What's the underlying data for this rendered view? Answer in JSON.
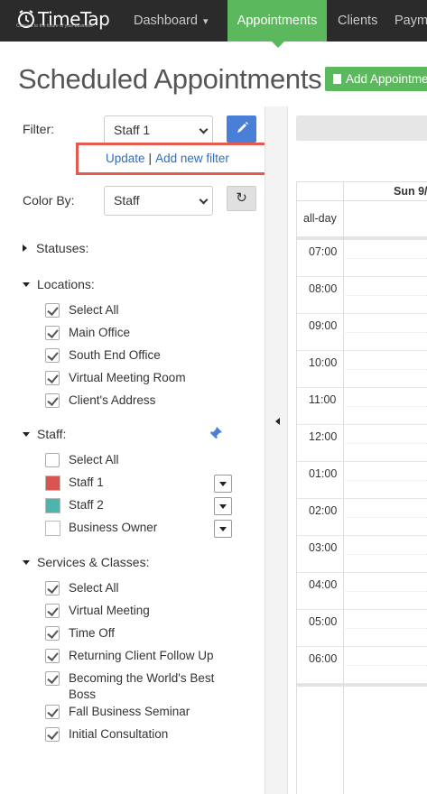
{
  "nav": {
    "logo_text": "TimeTap",
    "logo_tagline": "Connect to the future of your business",
    "items": [
      {
        "label": "Dashboard",
        "active": false,
        "dropdown": true
      },
      {
        "label": "Appointments",
        "active": true,
        "dropdown": false
      },
      {
        "label": "Clients",
        "active": false,
        "dropdown": false
      },
      {
        "label": "Paym",
        "active": false,
        "dropdown": false
      }
    ]
  },
  "header": {
    "title": "Scheduled Appointments",
    "add_button_label": "Add Appointme"
  },
  "filter": {
    "label": "Filter:",
    "selected": "Staff 1",
    "update_link": "Update",
    "separator": "|",
    "add_filter_link": "Add new filter",
    "edit_icon": "pencil-icon"
  },
  "color_by": {
    "label": "Color By:",
    "selected": "Staff",
    "refresh_icon": "refresh-icon"
  },
  "sections": {
    "statuses": {
      "label": "Statuses:",
      "expanded": false
    },
    "locations": {
      "label": "Locations:",
      "expanded": true,
      "items": [
        {
          "label": "Select All",
          "checked": true
        },
        {
          "label": "Main Office",
          "checked": true
        },
        {
          "label": "South End Office",
          "checked": true
        },
        {
          "label": "Virtual Meeting Room",
          "checked": true
        },
        {
          "label": "Client's Address",
          "checked": true
        }
      ]
    },
    "staff": {
      "label": "Staff:",
      "expanded": true,
      "pin_icon": "pin-icon",
      "items": [
        {
          "label": "Select All",
          "color": null
        },
        {
          "label": "Staff 1",
          "color": "#d9534f"
        },
        {
          "label": "Staff 2",
          "color": "#4db6ac"
        },
        {
          "label": "Business Owner",
          "color": "#ffffff"
        }
      ]
    },
    "services": {
      "label": "Services & Classes:",
      "expanded": true,
      "items": [
        {
          "label": "Select All",
          "checked": true
        },
        {
          "label": "Virtual Meeting",
          "checked": true
        },
        {
          "label": "Time Off",
          "checked": true
        },
        {
          "label": "Returning Client Follow Up",
          "checked": true
        },
        {
          "label": "Becoming the World's Best",
          "label2": "Boss",
          "checked": true
        },
        {
          "label": "Fall Business Seminar",
          "checked": true
        },
        {
          "label": "Initial Consultation",
          "checked": true
        }
      ]
    }
  },
  "calendar": {
    "day_header": "Sun 9/",
    "allday_label": "all-day",
    "time_slots": [
      "07:00",
      "08:00",
      "09:00",
      "10:00",
      "11:00",
      "12:00",
      "01:00",
      "02:00",
      "03:00",
      "04:00",
      "05:00",
      "06:00"
    ]
  },
  "colors": {
    "nav_bg": "#2b2b2b",
    "accent_green": "#5cb85c",
    "accent_blue": "#4a7fd8",
    "highlight_red": "#e55a4e",
    "link_blue": "#2f6fbd"
  }
}
